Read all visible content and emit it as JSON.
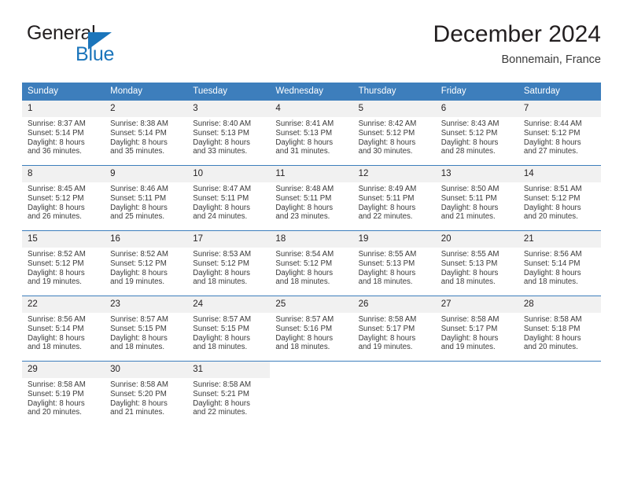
{
  "brand": {
    "name_part1": "General",
    "name_part2": "Blue",
    "accent_color": "#1b75bb"
  },
  "header": {
    "title": "December 2024",
    "subtitle": "Bonnemain, France"
  },
  "theme": {
    "header_bg": "#3d7ebc",
    "daynum_bg": "#f1f1f1",
    "text": "#231f20"
  },
  "weekdays": [
    "Sunday",
    "Monday",
    "Tuesday",
    "Wednesday",
    "Thursday",
    "Friday",
    "Saturday"
  ],
  "weeks": [
    [
      {
        "day": "1",
        "sunrise": "Sunrise: 8:37 AM",
        "sunset": "Sunset: 5:14 PM",
        "daylight1": "Daylight: 8 hours",
        "daylight2": "and 36 minutes."
      },
      {
        "day": "2",
        "sunrise": "Sunrise: 8:38 AM",
        "sunset": "Sunset: 5:14 PM",
        "daylight1": "Daylight: 8 hours",
        "daylight2": "and 35 minutes."
      },
      {
        "day": "3",
        "sunrise": "Sunrise: 8:40 AM",
        "sunset": "Sunset: 5:13 PM",
        "daylight1": "Daylight: 8 hours",
        "daylight2": "and 33 minutes."
      },
      {
        "day": "4",
        "sunrise": "Sunrise: 8:41 AM",
        "sunset": "Sunset: 5:13 PM",
        "daylight1": "Daylight: 8 hours",
        "daylight2": "and 31 minutes."
      },
      {
        "day": "5",
        "sunrise": "Sunrise: 8:42 AM",
        "sunset": "Sunset: 5:12 PM",
        "daylight1": "Daylight: 8 hours",
        "daylight2": "and 30 minutes."
      },
      {
        "day": "6",
        "sunrise": "Sunrise: 8:43 AM",
        "sunset": "Sunset: 5:12 PM",
        "daylight1": "Daylight: 8 hours",
        "daylight2": "and 28 minutes."
      },
      {
        "day": "7",
        "sunrise": "Sunrise: 8:44 AM",
        "sunset": "Sunset: 5:12 PM",
        "daylight1": "Daylight: 8 hours",
        "daylight2": "and 27 minutes."
      }
    ],
    [
      {
        "day": "8",
        "sunrise": "Sunrise: 8:45 AM",
        "sunset": "Sunset: 5:12 PM",
        "daylight1": "Daylight: 8 hours",
        "daylight2": "and 26 minutes."
      },
      {
        "day": "9",
        "sunrise": "Sunrise: 8:46 AM",
        "sunset": "Sunset: 5:11 PM",
        "daylight1": "Daylight: 8 hours",
        "daylight2": "and 25 minutes."
      },
      {
        "day": "10",
        "sunrise": "Sunrise: 8:47 AM",
        "sunset": "Sunset: 5:11 PM",
        "daylight1": "Daylight: 8 hours",
        "daylight2": "and 24 minutes."
      },
      {
        "day": "11",
        "sunrise": "Sunrise: 8:48 AM",
        "sunset": "Sunset: 5:11 PM",
        "daylight1": "Daylight: 8 hours",
        "daylight2": "and 23 minutes."
      },
      {
        "day": "12",
        "sunrise": "Sunrise: 8:49 AM",
        "sunset": "Sunset: 5:11 PM",
        "daylight1": "Daylight: 8 hours",
        "daylight2": "and 22 minutes."
      },
      {
        "day": "13",
        "sunrise": "Sunrise: 8:50 AM",
        "sunset": "Sunset: 5:11 PM",
        "daylight1": "Daylight: 8 hours",
        "daylight2": "and 21 minutes."
      },
      {
        "day": "14",
        "sunrise": "Sunrise: 8:51 AM",
        "sunset": "Sunset: 5:12 PM",
        "daylight1": "Daylight: 8 hours",
        "daylight2": "and 20 minutes."
      }
    ],
    [
      {
        "day": "15",
        "sunrise": "Sunrise: 8:52 AM",
        "sunset": "Sunset: 5:12 PM",
        "daylight1": "Daylight: 8 hours",
        "daylight2": "and 19 minutes."
      },
      {
        "day": "16",
        "sunrise": "Sunrise: 8:52 AM",
        "sunset": "Sunset: 5:12 PM",
        "daylight1": "Daylight: 8 hours",
        "daylight2": "and 19 minutes."
      },
      {
        "day": "17",
        "sunrise": "Sunrise: 8:53 AM",
        "sunset": "Sunset: 5:12 PM",
        "daylight1": "Daylight: 8 hours",
        "daylight2": "and 18 minutes."
      },
      {
        "day": "18",
        "sunrise": "Sunrise: 8:54 AM",
        "sunset": "Sunset: 5:12 PM",
        "daylight1": "Daylight: 8 hours",
        "daylight2": "and 18 minutes."
      },
      {
        "day": "19",
        "sunrise": "Sunrise: 8:55 AM",
        "sunset": "Sunset: 5:13 PM",
        "daylight1": "Daylight: 8 hours",
        "daylight2": "and 18 minutes."
      },
      {
        "day": "20",
        "sunrise": "Sunrise: 8:55 AM",
        "sunset": "Sunset: 5:13 PM",
        "daylight1": "Daylight: 8 hours",
        "daylight2": "and 18 minutes."
      },
      {
        "day": "21",
        "sunrise": "Sunrise: 8:56 AM",
        "sunset": "Sunset: 5:14 PM",
        "daylight1": "Daylight: 8 hours",
        "daylight2": "and 18 minutes."
      }
    ],
    [
      {
        "day": "22",
        "sunrise": "Sunrise: 8:56 AM",
        "sunset": "Sunset: 5:14 PM",
        "daylight1": "Daylight: 8 hours",
        "daylight2": "and 18 minutes."
      },
      {
        "day": "23",
        "sunrise": "Sunrise: 8:57 AM",
        "sunset": "Sunset: 5:15 PM",
        "daylight1": "Daylight: 8 hours",
        "daylight2": "and 18 minutes."
      },
      {
        "day": "24",
        "sunrise": "Sunrise: 8:57 AM",
        "sunset": "Sunset: 5:15 PM",
        "daylight1": "Daylight: 8 hours",
        "daylight2": "and 18 minutes."
      },
      {
        "day": "25",
        "sunrise": "Sunrise: 8:57 AM",
        "sunset": "Sunset: 5:16 PM",
        "daylight1": "Daylight: 8 hours",
        "daylight2": "and 18 minutes."
      },
      {
        "day": "26",
        "sunrise": "Sunrise: 8:58 AM",
        "sunset": "Sunset: 5:17 PM",
        "daylight1": "Daylight: 8 hours",
        "daylight2": "and 19 minutes."
      },
      {
        "day": "27",
        "sunrise": "Sunrise: 8:58 AM",
        "sunset": "Sunset: 5:17 PM",
        "daylight1": "Daylight: 8 hours",
        "daylight2": "and 19 minutes."
      },
      {
        "day": "28",
        "sunrise": "Sunrise: 8:58 AM",
        "sunset": "Sunset: 5:18 PM",
        "daylight1": "Daylight: 8 hours",
        "daylight2": "and 20 minutes."
      }
    ],
    [
      {
        "day": "29",
        "sunrise": "Sunrise: 8:58 AM",
        "sunset": "Sunset: 5:19 PM",
        "daylight1": "Daylight: 8 hours",
        "daylight2": "and 20 minutes."
      },
      {
        "day": "30",
        "sunrise": "Sunrise: 8:58 AM",
        "sunset": "Sunset: 5:20 PM",
        "daylight1": "Daylight: 8 hours",
        "daylight2": "and 21 minutes."
      },
      {
        "day": "31",
        "sunrise": "Sunrise: 8:58 AM",
        "sunset": "Sunset: 5:21 PM",
        "daylight1": "Daylight: 8 hours",
        "daylight2": "and 22 minutes."
      },
      {
        "day": "",
        "sunrise": "",
        "sunset": "",
        "daylight1": "",
        "daylight2": ""
      },
      {
        "day": "",
        "sunrise": "",
        "sunset": "",
        "daylight1": "",
        "daylight2": ""
      },
      {
        "day": "",
        "sunrise": "",
        "sunset": "",
        "daylight1": "",
        "daylight2": ""
      },
      {
        "day": "",
        "sunrise": "",
        "sunset": "",
        "daylight1": "",
        "daylight2": ""
      }
    ]
  ]
}
